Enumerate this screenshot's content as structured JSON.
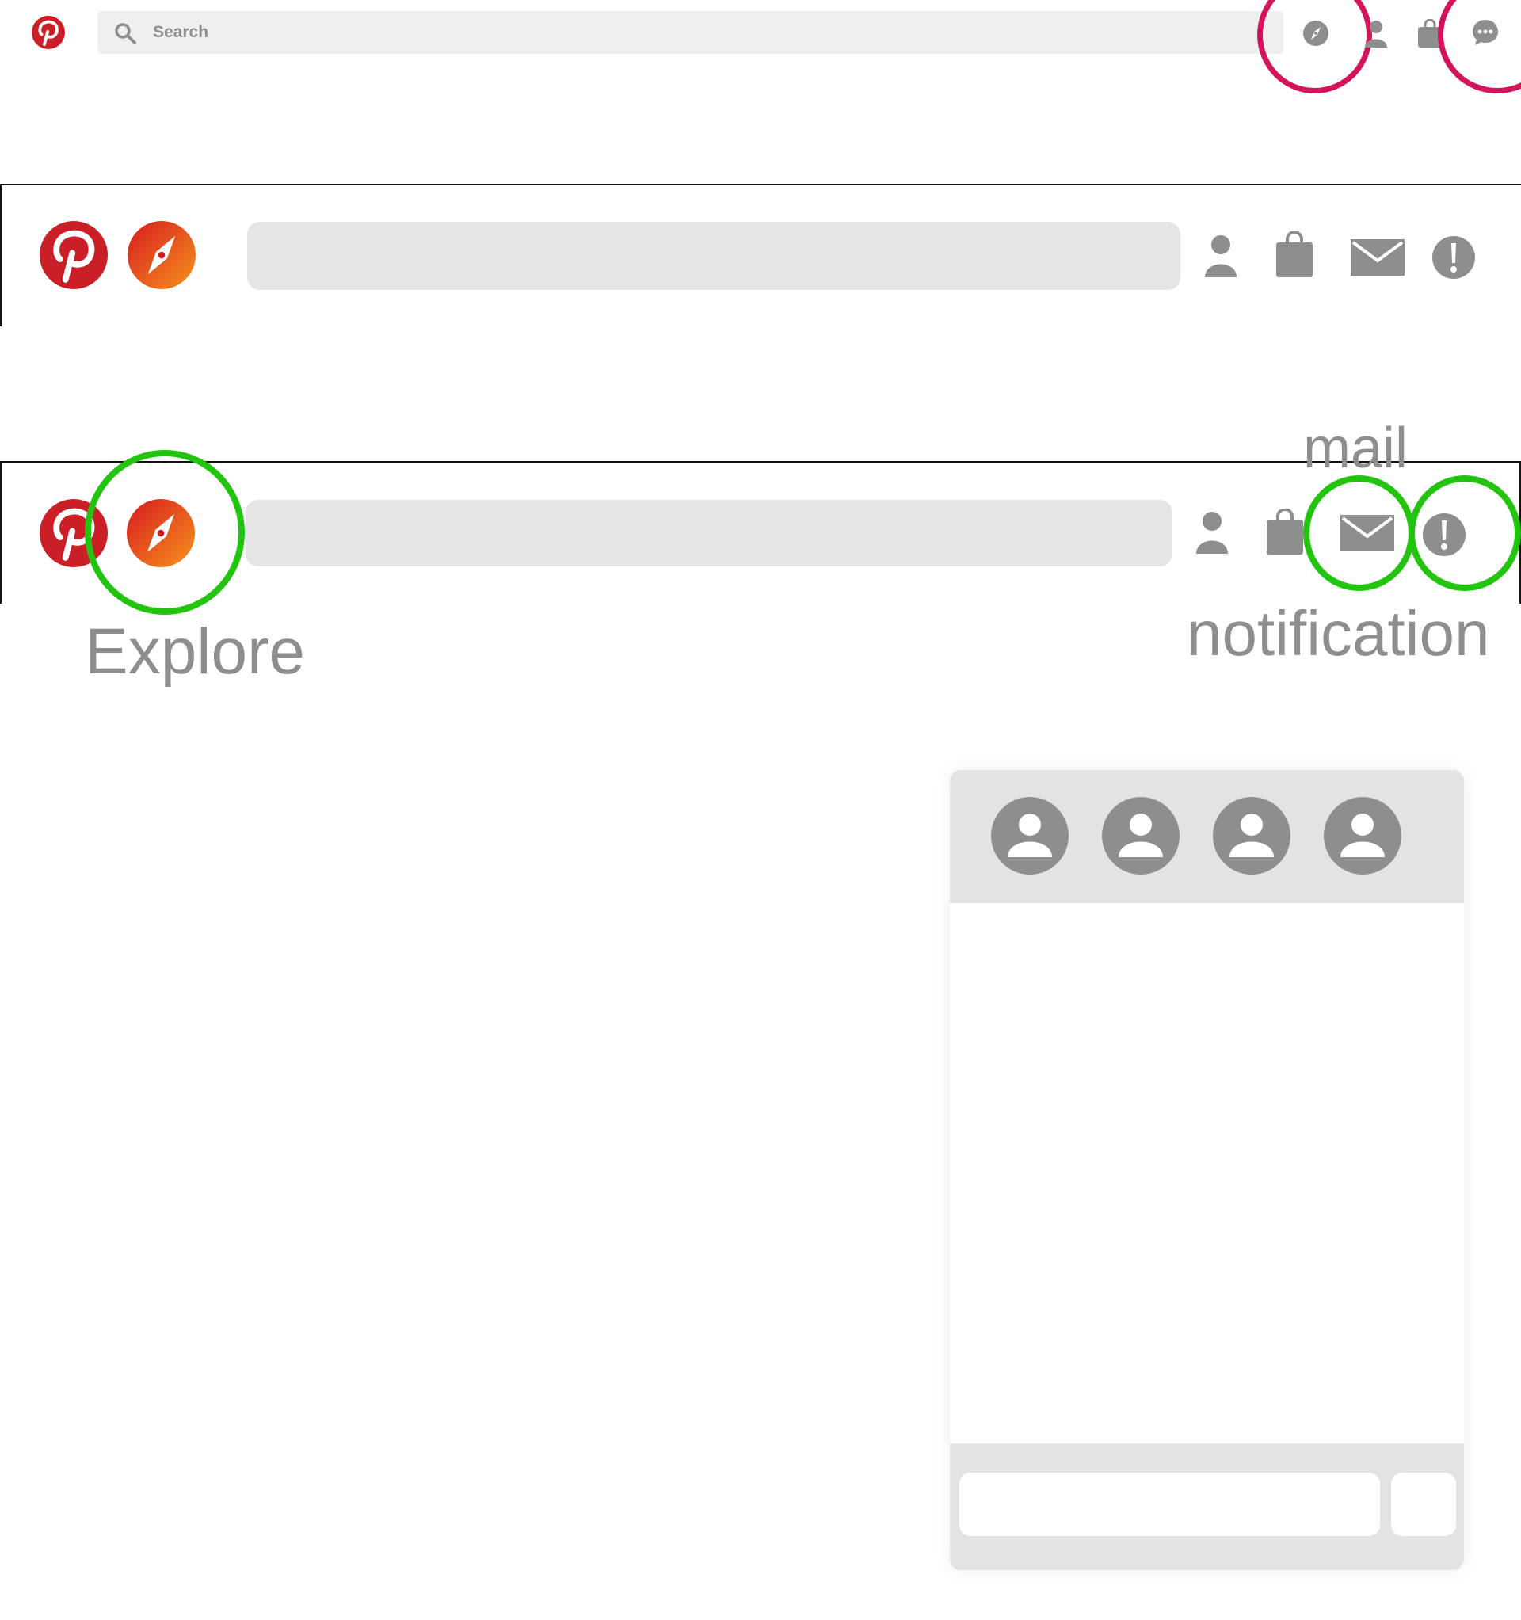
{
  "colors": {
    "pinterest_red": "#cb1f27",
    "highlight_red": "#d4145a",
    "highlight_green": "#22c40f",
    "icon_gray": "#8e8e8e",
    "search_bg_light": "#efefef",
    "search_bg": "#e5e5e5",
    "panel_gray": "#e3e3e3",
    "compass_gradient": [
      "#d6191e",
      "#f7941d"
    ]
  },
  "original_header": {
    "logo_icon": "pinterest-logo-icon",
    "search": {
      "placeholder": "Search",
      "icon": "search-icon"
    },
    "icons": [
      "compass-icon",
      "person-icon",
      "shopping-bag-icon",
      "chat-bubble-icon"
    ],
    "highlighted_icons": [
      "compass-icon",
      "chat-bubble-icon"
    ]
  },
  "redesign_header": {
    "logo_icon": "pinterest-logo-icon",
    "explore_icon": "compass-icon",
    "search": {
      "placeholder": ""
    },
    "icons": [
      "person-icon",
      "shopping-bag-icon",
      "mail-icon",
      "alert-icon"
    ]
  },
  "annotated_header": {
    "logo_icon": "pinterest-logo-icon",
    "explore_icon": "compass-icon",
    "search": {
      "placeholder": ""
    },
    "icons": [
      "person-icon",
      "shopping-bag-icon",
      "mail-icon",
      "alert-icon"
    ],
    "labels": {
      "explore": "Explore",
      "mail": "mail",
      "notification": "notification"
    }
  },
  "chat_panel": {
    "participants": [
      {
        "icon": "user-avatar-icon"
      },
      {
        "icon": "user-avatar-icon"
      },
      {
        "icon": "user-avatar-icon"
      },
      {
        "icon": "user-avatar-icon"
      }
    ],
    "message_input": {
      "value": "",
      "placeholder": ""
    },
    "send_button": {
      "label": ""
    }
  }
}
